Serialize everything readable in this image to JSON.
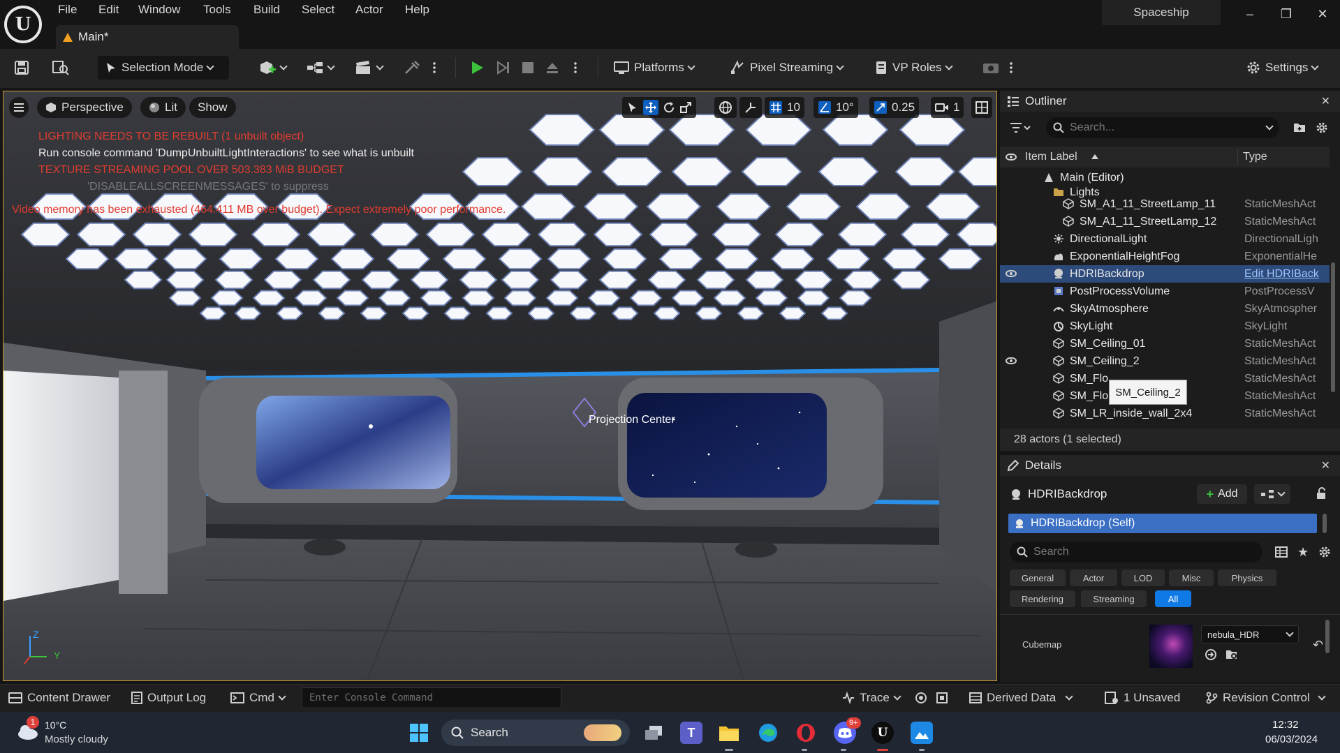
{
  "titlebar": {
    "menu": [
      "File",
      "Edit",
      "Window",
      "Tools",
      "Build",
      "Select",
      "Actor",
      "Help"
    ],
    "tab_label": "Main*",
    "project_name": "Spaceship"
  },
  "toolbar": {
    "mode_label": "Selection Mode",
    "platforms_label": "Platforms",
    "pixel_streaming_label": "Pixel Streaming",
    "vp_roles_label": "VP Roles",
    "settings_label": "Settings"
  },
  "viewport": {
    "perspective_label": "Perspective",
    "lit_label": "Lit",
    "show_label": "Show",
    "grid_snap": "10",
    "rotation_snap": "10°",
    "scale_snap": "0.25",
    "camera_speed": "1",
    "messages": {
      "lighting_rebuild": "LIGHTING NEEDS TO BE REBUILT (1 unbuilt object)",
      "console_hint": "Run console command 'DumpUnbuiltLightInteractions' to see what is unbuilt",
      "texture_pool": "TEXTURE STREAMING POOL OVER 503.383 MiB BUDGET",
      "suppress_hint": "'DISABLEALLSCREENMESSAGES' to suppress",
      "video_memory": "Video memory has been exhausted (464.411 MB over budget). Expect extremely poor performance."
    },
    "projection_center_label": "Projection Center",
    "axis_z": "Z",
    "axis_y": "Y"
  },
  "outliner": {
    "title": "Outliner",
    "search_placeholder": "Search...",
    "col_item_label": "Item Label",
    "col_type": "Type",
    "rows": [
      {
        "name": "Main (Editor)",
        "type": ""
      },
      {
        "name": "Lights",
        "type": ""
      },
      {
        "name": "SM_A1_11_StreetLamp_11",
        "type": "StaticMeshAct"
      },
      {
        "name": "SM_A1_11_StreetLamp_12",
        "type": "StaticMeshAct"
      },
      {
        "name": "DirectionalLight",
        "type": "DirectionalLigh"
      },
      {
        "name": "ExponentialHeightFog",
        "type": "ExponentialHe"
      },
      {
        "name": "HDRIBackdrop",
        "type": "Edit HDRIBack"
      },
      {
        "name": "PostProcessVolume",
        "type": "PostProcessV"
      },
      {
        "name": "SkyAtmosphere",
        "type": "SkyAtmospher"
      },
      {
        "name": "SkyLight",
        "type": "SkyLight"
      },
      {
        "name": "SM_Ceiling_01",
        "type": "StaticMeshAct"
      },
      {
        "name": "SM_Ceiling_2",
        "type": "StaticMeshAct"
      },
      {
        "name": "SM_Flo",
        "type": "StaticMeshAct"
      },
      {
        "name": "SM_Flo",
        "type": "StaticMeshAct"
      },
      {
        "name": "SM_LR_inside_wall_2x4",
        "type": "StaticMeshAct"
      }
    ],
    "tooltip": "SM_Ceiling_2",
    "footer": "28 actors (1 selected)"
  },
  "details": {
    "title": "Details",
    "actor_name": "HDRIBackdrop",
    "add_label": "Add",
    "self_row": "HDRIBackdrop (Self)",
    "search_placeholder": "Search",
    "categories": [
      "General",
      "Actor",
      "LOD",
      "Misc",
      "Physics",
      "Rendering",
      "Streaming",
      "All"
    ],
    "property_label": "Cubemap",
    "cubemap_value": "nebula_HDR"
  },
  "statusbar": {
    "content_drawer": "Content Drawer",
    "output_log": "Output Log",
    "cmd": "Cmd",
    "console_placeholder": "Enter Console Command",
    "trace": "Trace",
    "derived_data": "Derived Data",
    "unsaved": "1 Unsaved",
    "revision_control": "Revision Control"
  },
  "taskbar": {
    "weather_temp": "10°C",
    "weather_desc": "Mostly cloudy",
    "weather_badge": "1",
    "search_label": "Search",
    "discord_badge": "9+",
    "time": "12:32",
    "date": "06/03/2024"
  },
  "colors": {
    "accent_blue": "#0f7ae5",
    "selection": "#2c4a7a",
    "warning": "#e03c30",
    "play_green": "#3cc23c",
    "viewport_border": "#c99a2e"
  }
}
